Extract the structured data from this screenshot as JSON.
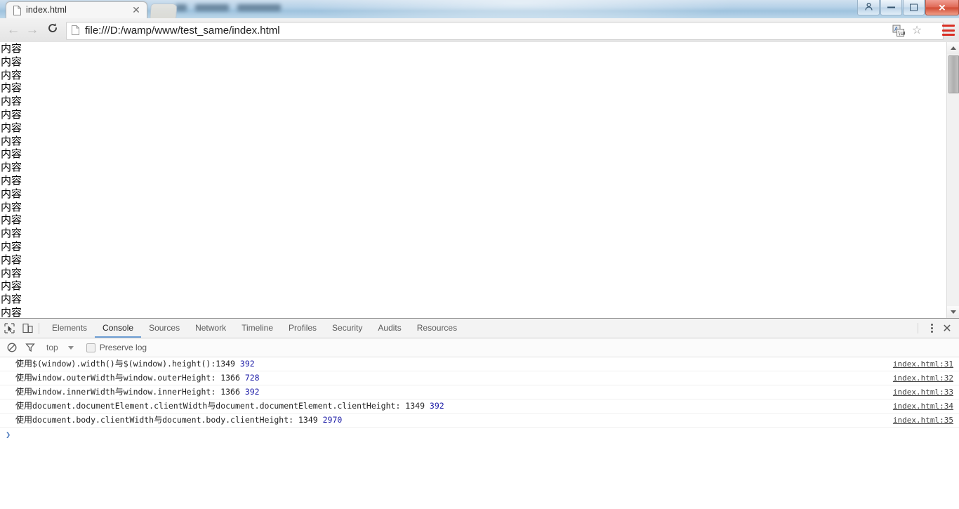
{
  "window": {
    "controls": {
      "user_label": "☺",
      "minimize_label": "",
      "maximize_label": "",
      "close_label": "✕"
    }
  },
  "tab": {
    "title": "index.html",
    "close_label": "✕"
  },
  "toolbar": {
    "back_label": "←",
    "forward_label": "→",
    "reload_label": "⟳",
    "url": "file:///D:/wamp/www/test_same/index.html",
    "star_label": "☆"
  },
  "page": {
    "line_text": "内容",
    "line_count": 21
  },
  "devtools": {
    "tabs": [
      {
        "label": "Elements",
        "active": false
      },
      {
        "label": "Console",
        "active": true
      },
      {
        "label": "Sources",
        "active": false
      },
      {
        "label": "Network",
        "active": false
      },
      {
        "label": "Timeline",
        "active": false
      },
      {
        "label": "Profiles",
        "active": false
      },
      {
        "label": "Security",
        "active": false
      },
      {
        "label": "Audits",
        "active": false
      },
      {
        "label": "Resources",
        "active": false
      }
    ],
    "filterbar": {
      "context": "top",
      "preserve_log_label": "Preserve log",
      "preserve_log_checked": false
    },
    "close_label": "✕",
    "console": {
      "messages": [
        {
          "zh_prefix": "使用",
          "code": "$(window).width()",
          "zh_mid": "与",
          "code2": "$(window).height():1349 ",
          "number": "392",
          "source": "index.html:31"
        },
        {
          "zh_prefix": "使用",
          "code": "window.outerWidth",
          "zh_mid": "与",
          "code2": "window.outerHeight: 1366 ",
          "number": "728",
          "source": "index.html:32"
        },
        {
          "zh_prefix": "使用",
          "code": "window.innerWidth",
          "zh_mid": "与",
          "code2": "window.innerHeight: 1366 ",
          "number": "392",
          "source": "index.html:33"
        },
        {
          "zh_prefix": "使用",
          "code": "document.documentElement.clientWidth",
          "zh_mid": "与",
          "code2": "document.documentElement.clientHeight: 1349 ",
          "number": "392",
          "source": "index.html:34"
        },
        {
          "zh_prefix": "使用",
          "code": "document.body.clientWidth",
          "zh_mid": "与",
          "code2": "document.body.clientHeight: 1349 ",
          "number": "2970",
          "source": "index.html:35"
        }
      ],
      "prompt_chevron": "❯",
      "prompt_value": ""
    }
  },
  "colors": {
    "accent_tab_underline": "#6e9fd4",
    "menu_red": "#d93025",
    "number_blue": "#1a1aa6",
    "close_red": "#d14a33"
  }
}
